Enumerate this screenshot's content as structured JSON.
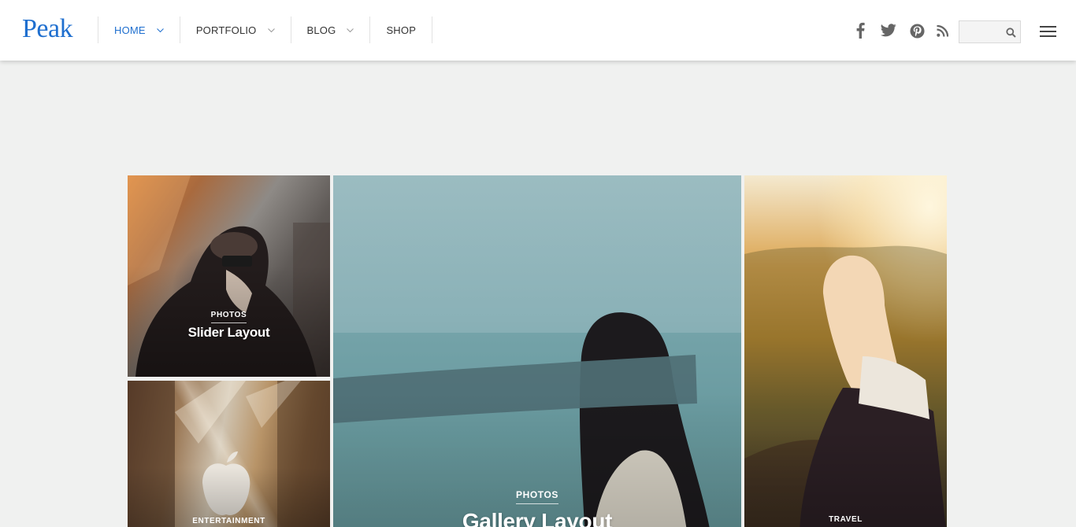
{
  "brand": {
    "logo": "Peak",
    "logo_color": "#1f6fcf"
  },
  "nav": {
    "items": [
      {
        "label": "HOME",
        "active": true,
        "has_dropdown": true
      },
      {
        "label": "PORTFOLIO",
        "active": false,
        "has_dropdown": true
      },
      {
        "label": "BLOG",
        "active": false,
        "has_dropdown": true
      },
      {
        "label": "SHOP",
        "active": false,
        "has_dropdown": false
      }
    ]
  },
  "social": [
    "facebook-icon",
    "twitter-icon",
    "pinterest-icon",
    "rss-icon"
  ],
  "search": {
    "value": "",
    "placeholder": ""
  },
  "tiles": [
    {
      "category": "PHOTOS",
      "title": "Slider Layout"
    },
    {
      "category": "ENTERTAINMENT",
      "title": ""
    },
    {
      "category": "PHOTOS",
      "title": "Gallery Layout"
    },
    {
      "category": "TRAVEL",
      "title": ""
    }
  ],
  "colors": {
    "accent": "#1f6fcf",
    "background": "#f0f1f0",
    "header": "#ffffff"
  }
}
